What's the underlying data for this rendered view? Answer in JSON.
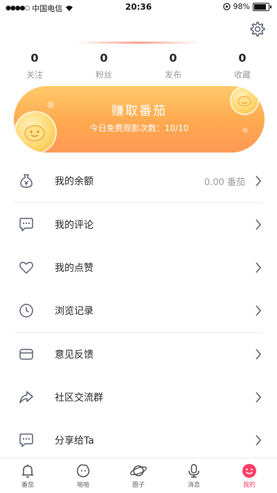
{
  "status_bar": {
    "carrier": "中国电信",
    "time": "20:36",
    "battery": "98%"
  },
  "stats": [
    {
      "value": "0",
      "label": "关注"
    },
    {
      "value": "0",
      "label": "粉丝"
    },
    {
      "value": "0",
      "label": "发布"
    },
    {
      "value": "0",
      "label": "收藏"
    }
  ],
  "banner": {
    "title": "赚取番茄",
    "subtitle": "今日免费观影次数：10/10"
  },
  "menu": [
    {
      "label": "我的余额",
      "value": "0.00 番茄",
      "icon": "money-bag-icon"
    },
    {
      "label": "我的评论",
      "value": "",
      "icon": "comment-icon"
    },
    {
      "label": "我的点赞",
      "value": "",
      "icon": "heart-icon"
    },
    {
      "label": "浏览记录",
      "value": "",
      "icon": "clock-icon"
    },
    {
      "label": "意见反馈",
      "value": "",
      "icon": "mailbox-icon"
    },
    {
      "label": "社区交流群",
      "value": "",
      "icon": "share-arrow-icon"
    },
    {
      "label": "分享给Ta",
      "value": "",
      "icon": "chat-bubble-icon"
    }
  ],
  "tabs": [
    {
      "label": "番茄",
      "icon": "bell-icon",
      "active": false
    },
    {
      "label": "啪啪",
      "icon": "tomato-face-icon",
      "active": false
    },
    {
      "label": "圈子",
      "icon": "planet-icon",
      "active": false
    },
    {
      "label": "消息",
      "icon": "microphone-icon",
      "active": false
    },
    {
      "label": "我的",
      "icon": "smile-face-icon",
      "active": true
    }
  ],
  "colors": {
    "accent": "#ff3e66",
    "banner_top": "#ffca6b",
    "banner_bottom": "#ff9a55",
    "icon_stroke": "#555a6e"
  }
}
